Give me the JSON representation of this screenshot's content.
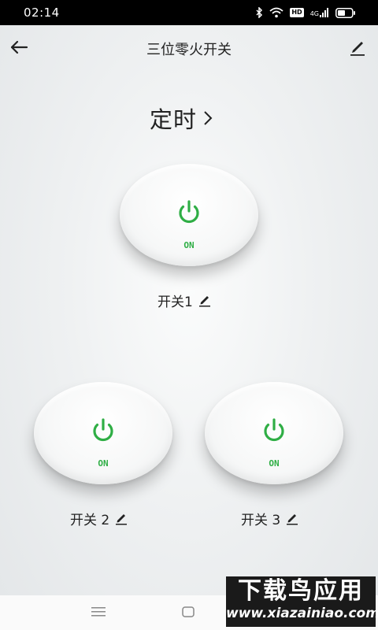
{
  "status_bar": {
    "time": "02:14",
    "hd_badge": "HD",
    "network": "4G",
    "icons": [
      "bluetooth-icon",
      "wifi-icon",
      "hd-icon",
      "signal-icon",
      "battery-icon"
    ]
  },
  "header": {
    "title": "三位零火开关",
    "icons": [
      "back-arrow-icon",
      "edit-icon"
    ]
  },
  "timer": {
    "label": "定时",
    "icon": "chevron-right-icon"
  },
  "switches": [
    {
      "label": "开关1",
      "state": "ON"
    },
    {
      "label": "开关 2",
      "state": "ON"
    },
    {
      "label": "开关 3",
      "state": "ON"
    }
  ],
  "bottom_nav": {
    "icons": [
      "menu-icon",
      "home-icon"
    ]
  },
  "watermark": {
    "title": "下载鸟应用",
    "url": "www.xiazainiao.com"
  },
  "colors": {
    "accent_green": "#2fae45",
    "status_bar": "#000000"
  }
}
